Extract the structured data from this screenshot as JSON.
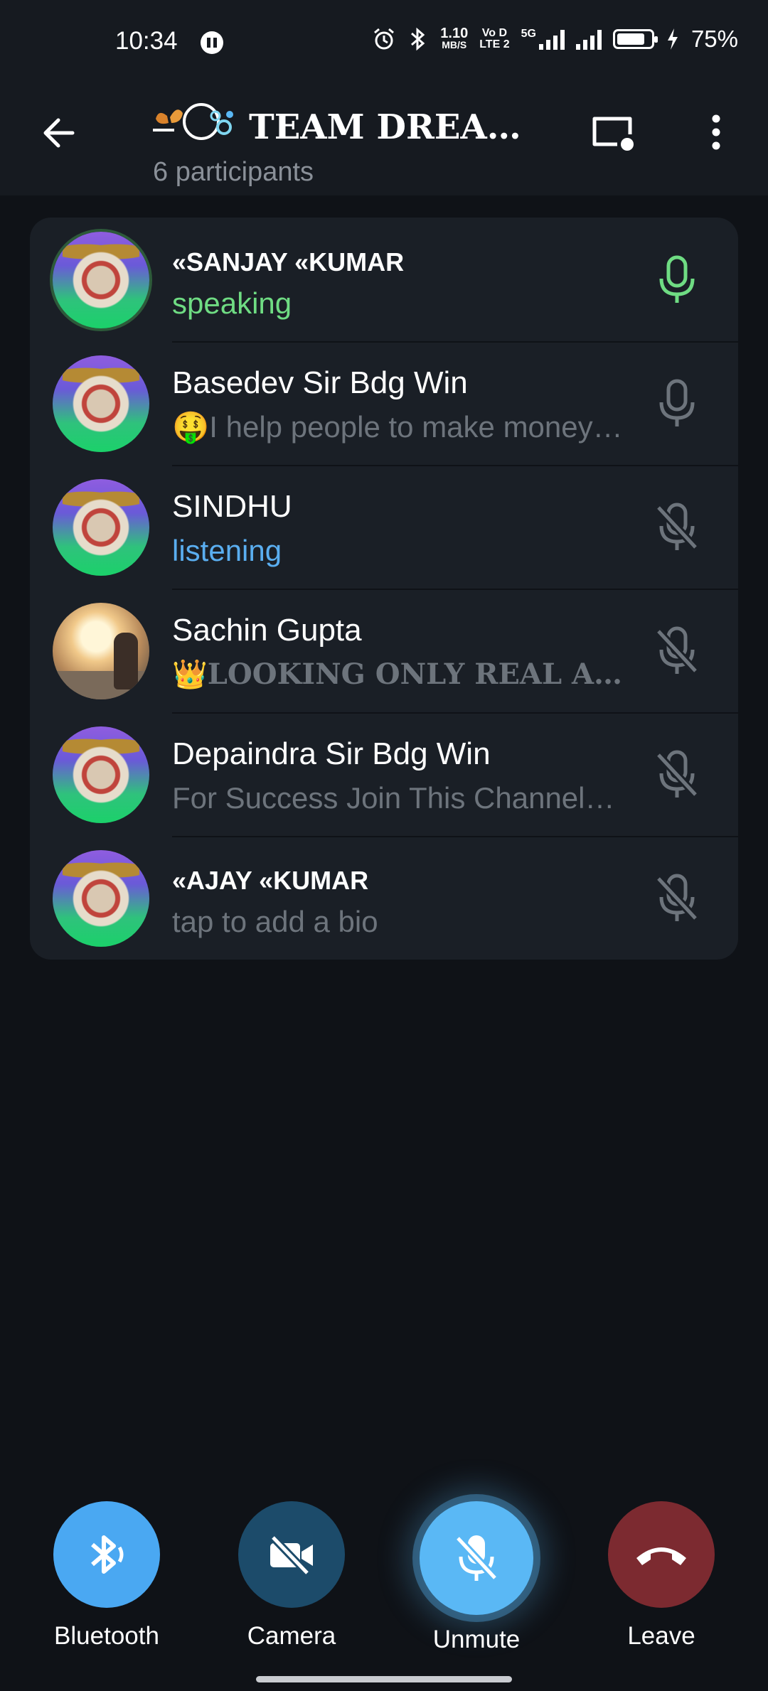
{
  "statusbar": {
    "time": "10:34",
    "net_speed_value": "1.10",
    "net_speed_unit": "MB/S",
    "volte_top": "Vo D",
    "volte_bottom": "LTE 2",
    "network": "5G",
    "battery": "75%",
    "icons": [
      "alarm-icon",
      "bluetooth-icon",
      "signal-icon",
      "battery-icon",
      "charging-icon"
    ]
  },
  "header": {
    "title": "TEAM DREA…",
    "subtitle": "6 participants",
    "icons": [
      "back-arrow-icon",
      "screen-share-icon",
      "more-vert-icon"
    ]
  },
  "participants": [
    {
      "name": "«SANJAY «KUMAR",
      "status": "speaking",
      "status_kind": "speaking",
      "mic": "active",
      "avatar": "team-logo"
    },
    {
      "name": "Basedev Sir Bdg Win",
      "status": "🤑I help people to make money…",
      "status_kind": "bio",
      "mic": "idle",
      "avatar": "team-logo"
    },
    {
      "name": "SINDHU",
      "status": "listening",
      "status_kind": "listening",
      "mic": "muted",
      "avatar": "team-logo"
    },
    {
      "name": "Sachin Gupta",
      "status": "👑LOOKING ONLY REAL A…",
      "status_kind": "bio-serif",
      "mic": "muted",
      "avatar": "photo"
    },
    {
      "name": "Depaindra Sir Bdg Win",
      "status": "For Success Join This Channel…",
      "status_kind": "bio",
      "mic": "muted",
      "avatar": "team-logo"
    },
    {
      "name": "«AJAY «KUMAR",
      "status": "tap to add a bio",
      "status_kind": "bio",
      "mic": "muted",
      "avatar": "team-logo"
    }
  ],
  "controls": {
    "bluetooth_label": "Bluetooth",
    "camera_label": "Camera",
    "unmute_label": "Unmute",
    "leave_label": "Leave"
  },
  "colors": {
    "background": "#0f1217",
    "card": "#1a1f26",
    "speaking": "#6fdc83",
    "listening": "#5aaef0",
    "muted_icon": "#6d747c",
    "bluetooth_button": "#4aa8f2",
    "camera_button": "#1c4b6a",
    "unmute_button": "#5ab8f5",
    "leave_button": "#7c2a30"
  }
}
